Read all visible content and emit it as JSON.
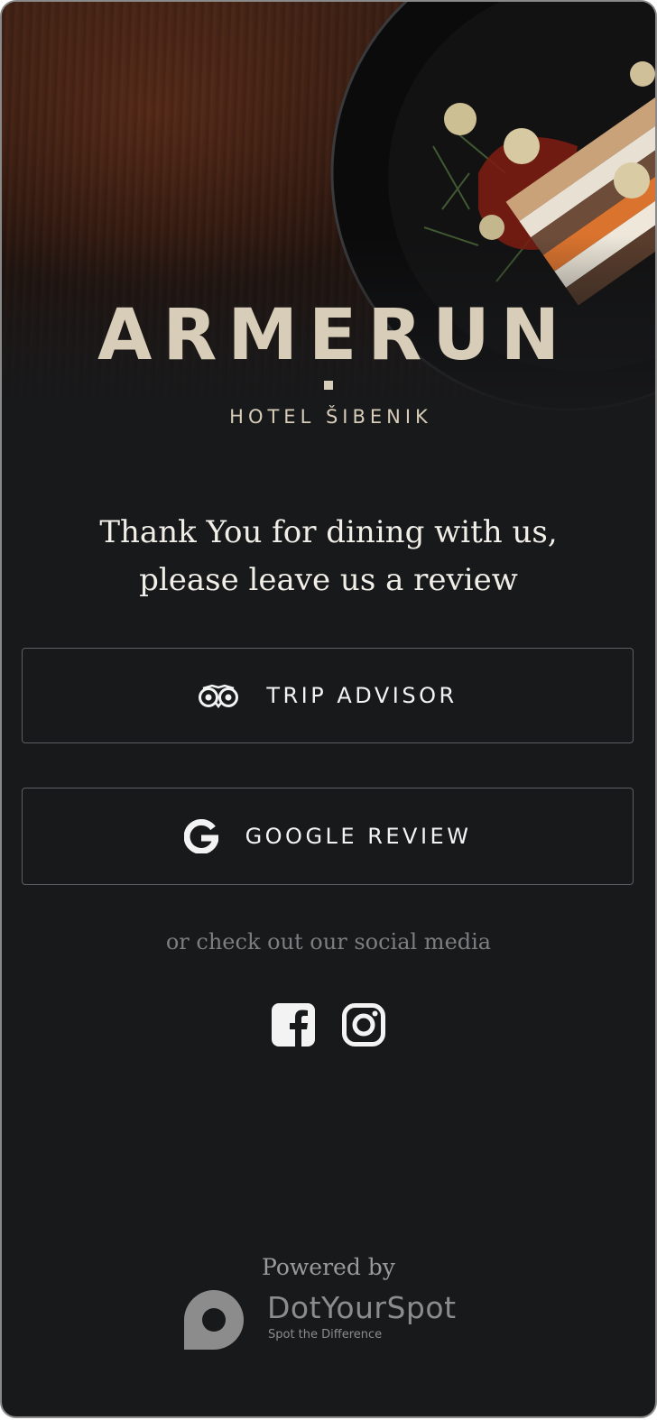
{
  "brand": {
    "name": "ARMERUN",
    "subtitle": "HOTEL ŠIBENIK"
  },
  "message": {
    "line1": "Thank You for dining with us,",
    "line2": "please leave us a review"
  },
  "buttons": {
    "tripadvisor": {
      "label": "TRIP ADVISOR",
      "icon": "tripadvisor-owl-icon"
    },
    "google": {
      "label": "GOOGLE REVIEW",
      "icon": "google-g-icon"
    }
  },
  "social": {
    "caption": "or check out our social media",
    "items": [
      {
        "name": "Facebook",
        "icon": "facebook-icon"
      },
      {
        "name": "Instagram",
        "icon": "instagram-icon"
      }
    ]
  },
  "footer": {
    "powered_by": "Powered by",
    "vendor_name": "DotYourSpot",
    "vendor_tagline": "Spot the Difference"
  },
  "colors": {
    "background": "#18191b",
    "brand_text": "#d7cdb8",
    "button_border": "#5d5f63",
    "muted_text": "#7e7e80"
  }
}
